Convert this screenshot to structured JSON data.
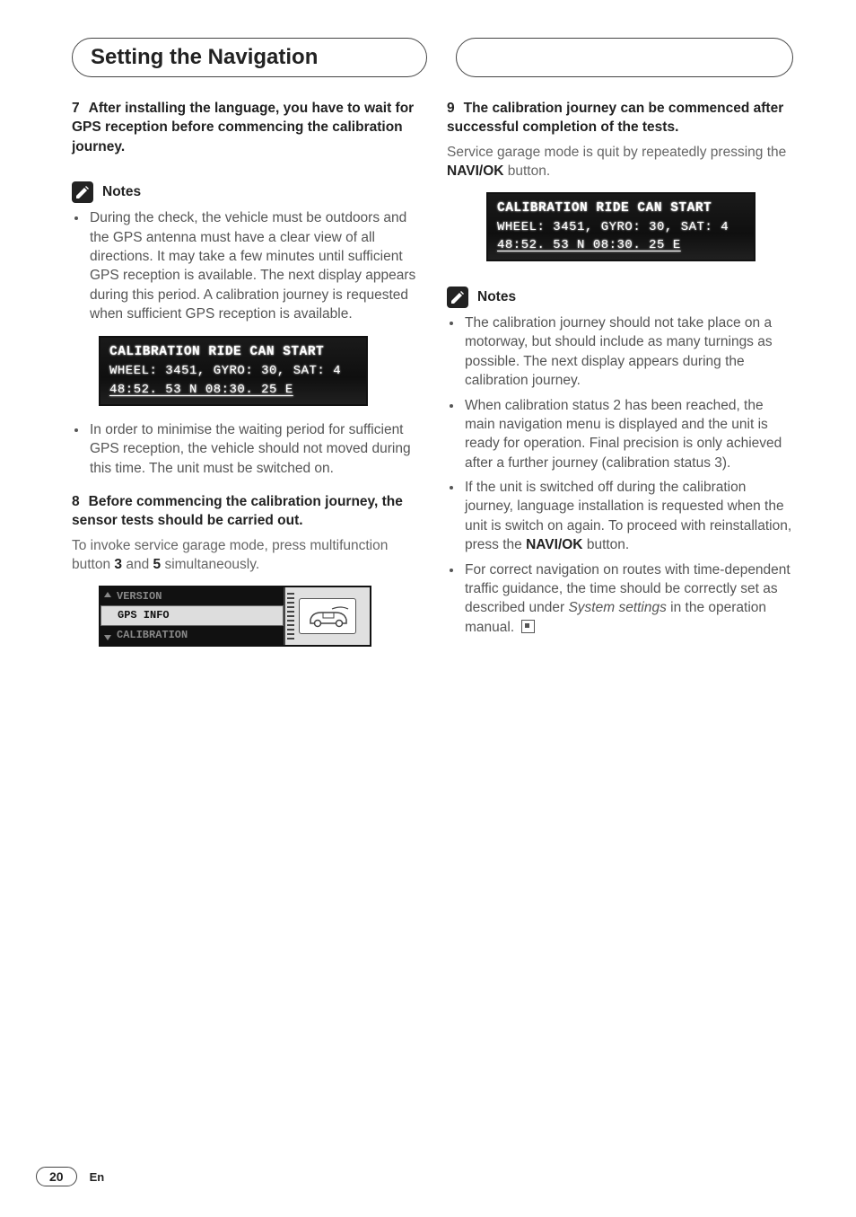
{
  "header": {
    "title": "Setting the Navigation"
  },
  "left": {
    "step7": {
      "num": "7",
      "text": "After installing the language, you have to wait for GPS reception before commencing the calibration journey."
    },
    "notes_label": "Notes",
    "note1": "During the check, the vehicle must be outdoors and the GPS antenna must have a clear view of all directions. It may take a few minutes until sufficient GPS reception is available. The next display appears during this period. A calibration journey is requested when sufficient GPS reception is available.",
    "lcd1": {
      "line1": "CALIBRATION RIDE CAN START",
      "line2": "WHEEL: 3451,   GYRO: 30,   SAT: 4",
      "line3": "48:52. 53 N   08:30. 25 E"
    },
    "note2": "In order to minimise the waiting period for sufficient GPS reception, the vehicle should not moved during this time. The unit must be switched on.",
    "step8": {
      "num": "8",
      "text": "Before commencing the calibration journey, the sensor tests should be carried out."
    },
    "step8_body_a": "To invoke service garage mode, press multifunction button ",
    "step8_b1": "3",
    "step8_body_b": " and ",
    "step8_b2": "5",
    "step8_body_c": " simultaneously.",
    "menu": {
      "item_up": "VERSION",
      "item_sel": "GPS INFO",
      "item_dn": "CALIBRATION"
    }
  },
  "right": {
    "step9": {
      "num": "9",
      "text": "The calibration journey can be commenced after successful completion of the tests."
    },
    "step9_body_a": "Service garage mode is quit by repeatedly pressing the ",
    "step9_navi": "NAVI/OK",
    "step9_body_b": " button.",
    "lcd2": {
      "line1": "CALIBRATION RIDE CAN START",
      "line2": "WHEEL: 3451,   GYRO: 30,   SAT: 4",
      "line3": "48:52. 53 N   08:30. 25 E"
    },
    "notes_label": "Notes",
    "rnote1": "The calibration journey should not take place on a motorway, but should include as many turnings as possible. The next display appears during the calibration journey.",
    "rnote2": "When calibration status 2 has been reached, the main navigation menu is displayed and the unit is ready for operation. Final precision is only achieved after a further journey (calibration status 3).",
    "rnote3_a": "If the unit is switched off during the calibration journey, language installation is requested when the unit is switch on again. To proceed with reinstallation, press the ",
    "rnote3_navi": "NAVI/OK",
    "rnote3_b": " button.",
    "rnote4_a": "For correct navigation on routes with time-dependent traffic guidance, the time should be correctly set as described under ",
    "rnote4_i": "System settings",
    "rnote4_b": " in the operation manual."
  },
  "footer": {
    "page": "20",
    "lang": "En"
  }
}
